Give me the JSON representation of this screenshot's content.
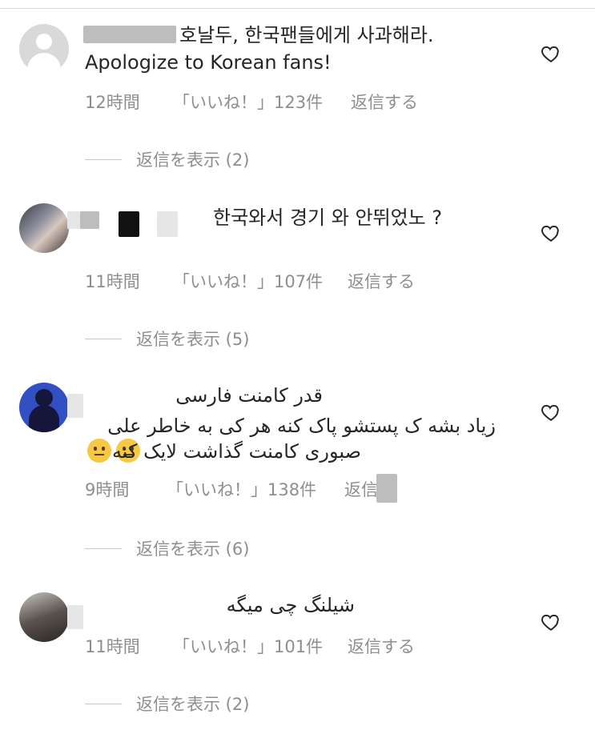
{
  "comments": [
    {
      "text_line1": "호날두, 한국팬들에게 사과해라.",
      "text_line2": "Apologize to Korean fans!",
      "time": "12時間",
      "likes": "「いいね！」123件",
      "reply": "返信する",
      "view_replies": "返信を表示 (2)"
    },
    {
      "text_line1": "한국와서 경기 와 안뛰었노 ?",
      "time": "11時間",
      "likes": "「いいね！」107件",
      "reply": "返信する",
      "view_replies": "返信を表示 (5)"
    },
    {
      "text_line1": "قدر کامنت فارسی",
      "text_line2": "زیاد بشه ک پستشو پاک کنه هر کی به خاطر علی",
      "text_line3": "صبوری کامنت گذاشت لایک کنه",
      "time": "9時間",
      "likes": "「いいね！」138件",
      "reply": "返信",
      "view_replies": "返信を表示 (6)"
    },
    {
      "text_line1": "شیلنگ چی میگه",
      "time": "11時間",
      "likes": "「いいね！」101件",
      "reply": "返信する",
      "view_replies": "返信を表示 (2)"
    }
  ]
}
